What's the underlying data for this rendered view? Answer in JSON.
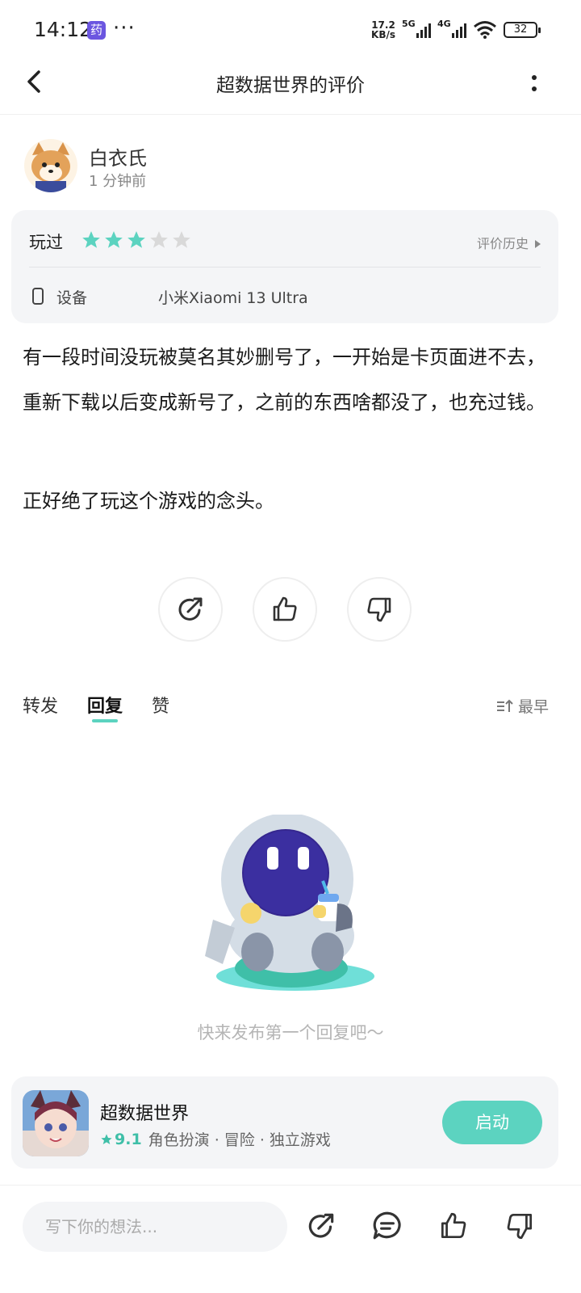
{
  "status_bar": {
    "time": "14:12",
    "app_badge": "药",
    "dots": "···",
    "speed_value": "17.2",
    "speed_unit": "KB/s",
    "signal1_label": "5G",
    "signal2_label": "4G",
    "battery": "32"
  },
  "header": {
    "title": "超数据世界的评价"
  },
  "author": {
    "name": "白衣氏",
    "time": "1 分钟前"
  },
  "rating_card": {
    "played_label": "玩过",
    "rating": 3,
    "max_rating": 5,
    "history_label": "评价历史",
    "device_label": "设备",
    "device_value": "小米Xiaomi 13 Ultra"
  },
  "review": {
    "paragraph1": "有一段时间没玩被莫名其妙删号了，一开始是卡页面进不去，重新下载以后变成新号了，之前的东西啥都没了，也充过钱。",
    "paragraph2": "正好绝了玩这个游戏的念头。"
  },
  "tabs": {
    "items": [
      "转发",
      "回复",
      "赞"
    ],
    "active": "回复",
    "sort_label": "最早"
  },
  "empty_state": {
    "text": "快来发布第一个回复吧～"
  },
  "game": {
    "name": "超数据世界",
    "score": "9.1",
    "tags": "角色扮演 · 冒险 · 独立游戏",
    "launch_label": "启动"
  },
  "bottom_bar": {
    "placeholder": "写下你的想法..."
  },
  "colors": {
    "accent": "#5cd3c0",
    "card_bg": "#f4f5f7",
    "star_empty": "#d9d9d9"
  }
}
